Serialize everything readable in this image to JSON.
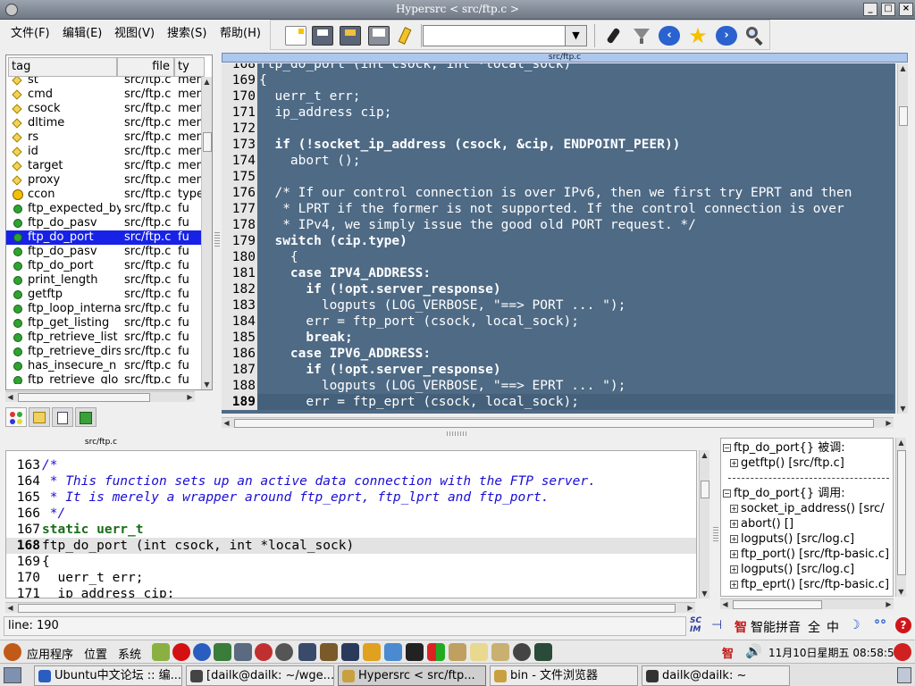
{
  "window": {
    "title": "Hypersrc < src/ftp.c >"
  },
  "menu": [
    "文件(F)",
    "编辑(E)",
    "视图(V)",
    "搜索(S)",
    "帮助(H)"
  ],
  "toolbar": {
    "search_value": ""
  },
  "tagpanel": {
    "columns": [
      "tag",
      "file",
      "ty"
    ],
    "rows": [
      {
        "name": "st",
        "file": "src/ftp.c",
        "type": "mem",
        "icon": "member"
      },
      {
        "name": "cmd",
        "file": "src/ftp.c",
        "type": "mem",
        "icon": "member"
      },
      {
        "name": "csock",
        "file": "src/ftp.c",
        "type": "mem",
        "icon": "member"
      },
      {
        "name": "dltime",
        "file": "src/ftp.c",
        "type": "mem",
        "icon": "member"
      },
      {
        "name": "rs",
        "file": "src/ftp.c",
        "type": "mem",
        "icon": "member"
      },
      {
        "name": "id",
        "file": "src/ftp.c",
        "type": "mem",
        "icon": "member"
      },
      {
        "name": "target",
        "file": "src/ftp.c",
        "type": "mem",
        "icon": "member"
      },
      {
        "name": "proxy",
        "file": "src/ftp.c",
        "type": "mem",
        "icon": "member"
      },
      {
        "name": "ccon",
        "file": "src/ftp.c",
        "type": "type",
        "icon": "type"
      },
      {
        "name": "ftp_expected_by",
        "file": "src/ftp.c",
        "type": "fu",
        "icon": "function"
      },
      {
        "name": "ftp_do_pasv",
        "file": "src/ftp.c",
        "type": "fu",
        "icon": "function"
      },
      {
        "name": "ftp_do_port",
        "file": "src/ftp.c",
        "type": "fu",
        "icon": "function",
        "selected": true
      },
      {
        "name": "ftp_do_pasv",
        "file": "src/ftp.c",
        "type": "fu",
        "icon": "function"
      },
      {
        "name": "ftp_do_port",
        "file": "src/ftp.c",
        "type": "fu",
        "icon": "function"
      },
      {
        "name": "print_length",
        "file": "src/ftp.c",
        "type": "fu",
        "icon": "function"
      },
      {
        "name": "getftp",
        "file": "src/ftp.c",
        "type": "fu",
        "icon": "function"
      },
      {
        "name": "ftp_loop_interna",
        "file": "src/ftp.c",
        "type": "fu",
        "icon": "function"
      },
      {
        "name": "ftp_get_listing",
        "file": "src/ftp.c",
        "type": "fu",
        "icon": "function"
      },
      {
        "name": "ftp_retrieve_list",
        "file": "src/ftp.c",
        "type": "fu",
        "icon": "function"
      },
      {
        "name": "ftp_retrieve_dirs",
        "file": "src/ftp.c",
        "type": "fu",
        "icon": "function"
      },
      {
        "name": "has_insecure_n",
        "file": "src/ftp.c",
        "type": "fu",
        "icon": "function"
      },
      {
        "name": "ftp_retrieve_glo",
        "file": "src/ftp.c",
        "type": "fu",
        "icon": "function"
      }
    ]
  },
  "code_top": {
    "tab": "src/ftp.c",
    "lines": [
      {
        "n": "168",
        "t": "ftp_do_port (int csock, int *local_sock)"
      },
      {
        "n": "169",
        "t": "{"
      },
      {
        "n": "170",
        "t": "  uerr_t err;"
      },
      {
        "n": "171",
        "t": "  ip_address cip;"
      },
      {
        "n": "172",
        "t": ""
      },
      {
        "n": "173",
        "t": "  if (!socket_ip_address (csock, &cip, ENDPOINT_PEER))"
      },
      {
        "n": "174",
        "t": "    abort ();"
      },
      {
        "n": "175",
        "t": ""
      },
      {
        "n": "176",
        "t": "  /* If our control connection is over IPv6, then we first try EPRT and then"
      },
      {
        "n": "177",
        "t": "   * LPRT if the former is not supported. If the control connection is over"
      },
      {
        "n": "178",
        "t": "   * IPv4, we simply issue the good old PORT request. */"
      },
      {
        "n": "179",
        "t": "  switch (cip.type)"
      },
      {
        "n": "180",
        "t": "    {"
      },
      {
        "n": "181",
        "t": "    case IPV4_ADDRESS:"
      },
      {
        "n": "182",
        "t": "      if (!opt.server_response)"
      },
      {
        "n": "183",
        "t": "        logputs (LOG_VERBOSE, \"==> PORT ... \");"
      },
      {
        "n": "184",
        "t": "      err = ftp_port (csock, local_sock);"
      },
      {
        "n": "185",
        "t": "      break;"
      },
      {
        "n": "186",
        "t": "    case IPV6_ADDRESS:"
      },
      {
        "n": "187",
        "t": "      if (!opt.server_response)"
      },
      {
        "n": "188",
        "t": "        logputs (LOG_VERBOSE, \"==> EPRT ... \");"
      },
      {
        "n": "189",
        "t": "      err = ftp_eprt (csock, local_sock);"
      }
    ]
  },
  "code_bottom": {
    "tab": "src/ftp.c",
    "lines": [
      {
        "n": "163",
        "t": "/*",
        "k": "cm"
      },
      {
        "n": "164",
        "t": " * This function sets up an active data connection with the FTP server.",
        "k": "cm"
      },
      {
        "n": "165",
        "t": " * It is merely a wrapper around ftp_eprt, ftp_lprt and ftp_port.",
        "k": "cm"
      },
      {
        "n": "166",
        "t": " */",
        "k": "cm"
      },
      {
        "n": "167",
        "t": "static uerr_t",
        "k": "kw"
      },
      {
        "n": "168",
        "t": "ftp_do_port (int csock, int *local_sock)",
        "k": "hl"
      },
      {
        "n": "169",
        "t": "{",
        "k": ""
      },
      {
        "n": "170",
        "t": "  uerr_t err;",
        "k": ""
      },
      {
        "n": "171",
        "t": "  ip_address cip;",
        "k": ""
      }
    ]
  },
  "callpanel": {
    "callers_title": "ftp_do_port{} 被调:",
    "callers": [
      "getftp() [src/ftp.c]"
    ],
    "callees_title": "ftp_do_port{} 调用:",
    "callees": [
      "socket_ip_address() [src/",
      "abort() []",
      "logputs() [src/log.c]",
      "ftp_port() [src/ftp-basic.c]",
      "logputs() [src/log.c]",
      "ftp_eprt() [src/ftp-basic.c]"
    ]
  },
  "status": {
    "line": "line: 190"
  },
  "ime": {
    "logo": "SCIM",
    "mode": "智能拼音",
    "full": "全",
    "lang": "中"
  },
  "gnome_panel": {
    "menus": [
      "应用程序",
      "位置",
      "系统"
    ],
    "clock": "11月10日星期五 08:58:52",
    "tasks": [
      {
        "label": "Ubuntu中文论坛 :: 编...",
        "active": false
      },
      {
        "label": "[dailk@dailk: ~/wge...",
        "active": false
      },
      {
        "label": "Hypersrc < src/ftp...",
        "active": true
      },
      {
        "label": "bin - 文件浏览器",
        "active": false
      },
      {
        "label": "dailk@dailk: ~",
        "active": false
      }
    ]
  }
}
